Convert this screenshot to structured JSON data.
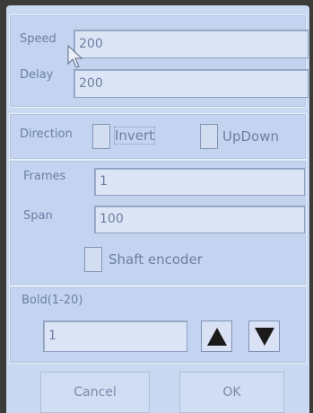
{
  "motion": {
    "speed_label": "Speed",
    "speed_value": "200",
    "delay_label": "Delay",
    "delay_value": "200"
  },
  "direction": {
    "label": "Direction",
    "invert_label": "Invert",
    "invert_checked": false,
    "updown_label": "UpDown",
    "updown_checked": false
  },
  "frames": {
    "frames_label": "Frames",
    "frames_value": "1",
    "span_label": "Span",
    "span_value": "100",
    "shaft_encoder_label": "Shaft encoder",
    "shaft_encoder_checked": false
  },
  "bold": {
    "label": "Bold(1-20)",
    "value": "1",
    "up_icon": "triangle-up-icon",
    "down_icon": "triangle-down-icon"
  },
  "actions": {
    "cancel_label": "Cancel",
    "ok_label": "OK"
  },
  "colors": {
    "background": "#c9d9f1",
    "text": "#6d7fa2",
    "arrow": "#1a1a1a"
  }
}
